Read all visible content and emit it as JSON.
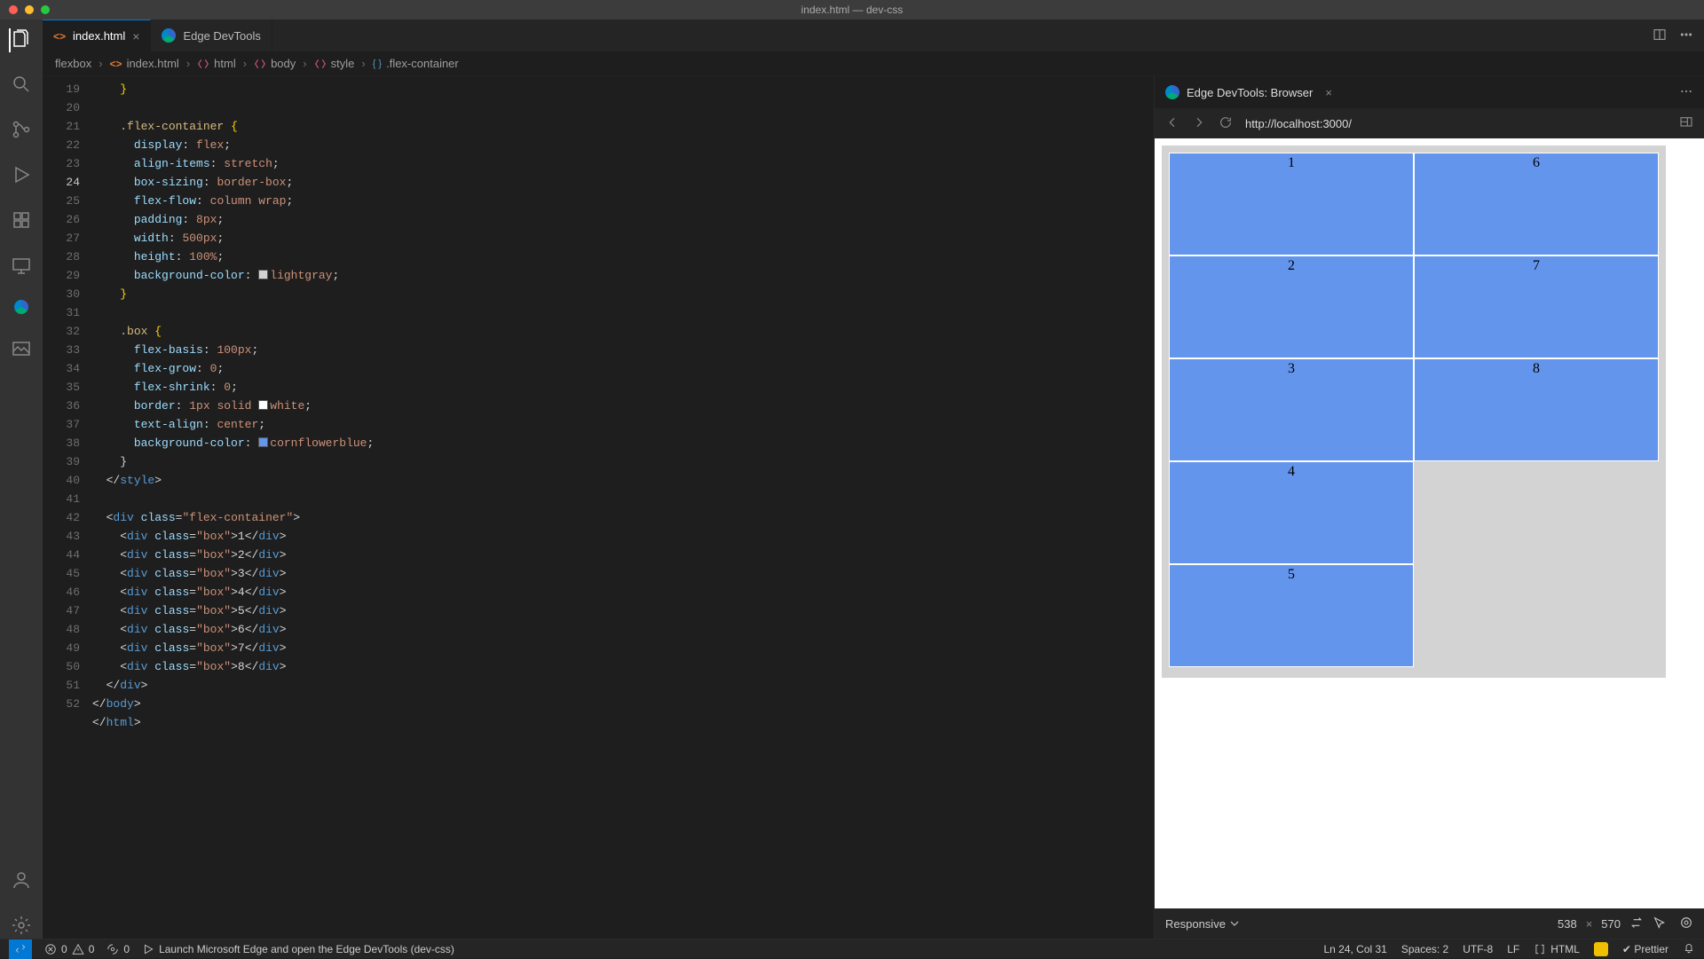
{
  "window": {
    "title": "index.html — dev-css"
  },
  "tabs": [
    {
      "label": "index.html",
      "active": true,
      "closeable": true
    },
    {
      "label": "Edge DevTools",
      "active": false,
      "closeable": false
    }
  ],
  "breadcrumbs": {
    "root": "flexbox",
    "file": "index.html",
    "path": [
      "html",
      "body",
      "style",
      ".flex-container"
    ]
  },
  "gutter": {
    "start": 19,
    "end": 52,
    "highlight": 24
  },
  "code": {
    "lines": [
      {
        "n": 19,
        "t": "      }"
      },
      {
        "n": 20,
        "t": ""
      },
      {
        "n": 21,
        "t": "      .flex-container {",
        "sel": ".flex-container"
      },
      {
        "n": 22,
        "t": "        display: flex;"
      },
      {
        "n": 23,
        "t": "        align-items: stretch;"
      },
      {
        "n": 24,
        "t": "        box-sizing: border-box;"
      },
      {
        "n": 25,
        "t": "        flex-flow: column wrap;"
      },
      {
        "n": 26,
        "t": "        padding: 8px;"
      },
      {
        "n": 27,
        "t": "        width: 500px;"
      },
      {
        "n": 28,
        "t": "        height: 100%;"
      },
      {
        "n": 29,
        "t": "        background-color: lightgray;"
      },
      {
        "n": 30,
        "t": "      }"
      },
      {
        "n": 31,
        "t": ""
      },
      {
        "n": 32,
        "t": "      .box {"
      },
      {
        "n": 33,
        "t": "        flex-basis: 100px;"
      },
      {
        "n": 34,
        "t": "        flex-grow: 0;"
      },
      {
        "n": 35,
        "t": "        flex-shrink: 0;"
      },
      {
        "n": 36,
        "t": "        border: 1px solid white;"
      },
      {
        "n": 37,
        "t": "        text-align: center;"
      },
      {
        "n": 38,
        "t": "        background-color: cornflowerblue;"
      },
      {
        "n": 39,
        "t": "      }"
      },
      {
        "n": 40,
        "t": "    </style>"
      }
    ],
    "swatches": {
      "lightgray": "#d3d3d3",
      "white": "#ffffff",
      "cornflowerblue": "#6495ed"
    }
  },
  "preview": {
    "tab_label": "Edge DevTools: Browser",
    "url": "http://localhost:3000/",
    "boxes": [
      "1",
      "2",
      "3",
      "4",
      "5",
      "6",
      "7",
      "8"
    ],
    "footer": {
      "mode": "Responsive",
      "w": "538",
      "h": "570"
    }
  },
  "status": {
    "errors": "0",
    "warnings": "0",
    "ports": "0",
    "launch": "Launch Microsoft Edge and open the Edge DevTools (dev-css)",
    "pos": "Ln 24, Col 31",
    "spaces": "Spaces: 2",
    "enc": "UTF-8",
    "eol": "LF",
    "lang": "HTML",
    "prettier": "Prettier"
  }
}
